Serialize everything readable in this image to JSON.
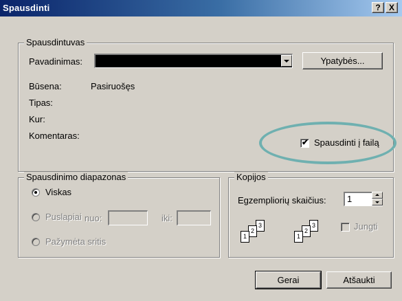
{
  "window": {
    "title": "Spausdinti",
    "help_btn": "?",
    "close_btn": "X"
  },
  "printer": {
    "group_label": "Spausdintuvas",
    "name_label": "Pavadinimas:",
    "properties_btn": "Ypatybės...",
    "status_label": "Būsena:",
    "status_value": "Pasiruošęs",
    "type_label": "Tipas:",
    "where_label": "Kur:",
    "comment_label": "Komentaras:",
    "print_to_file_label": "Spausdinti į failą",
    "print_to_file_checked": true
  },
  "range": {
    "group_label": "Spausdinimo diapazonas",
    "all_label": "Viskas",
    "pages_label": "Puslapiai",
    "from_label": "nuo:",
    "to_label": "iki:",
    "selection_label": "Pažymėta sritis"
  },
  "copies": {
    "group_label": "Kopijos",
    "count_label": "Egzempliorių skaičius:",
    "count_value": "1",
    "collate_label": "Jungti"
  },
  "buttons": {
    "ok": "Gerai",
    "cancel": "Atšaukti"
  },
  "colors": {
    "highlight_ellipse": "#6fb0b0"
  }
}
